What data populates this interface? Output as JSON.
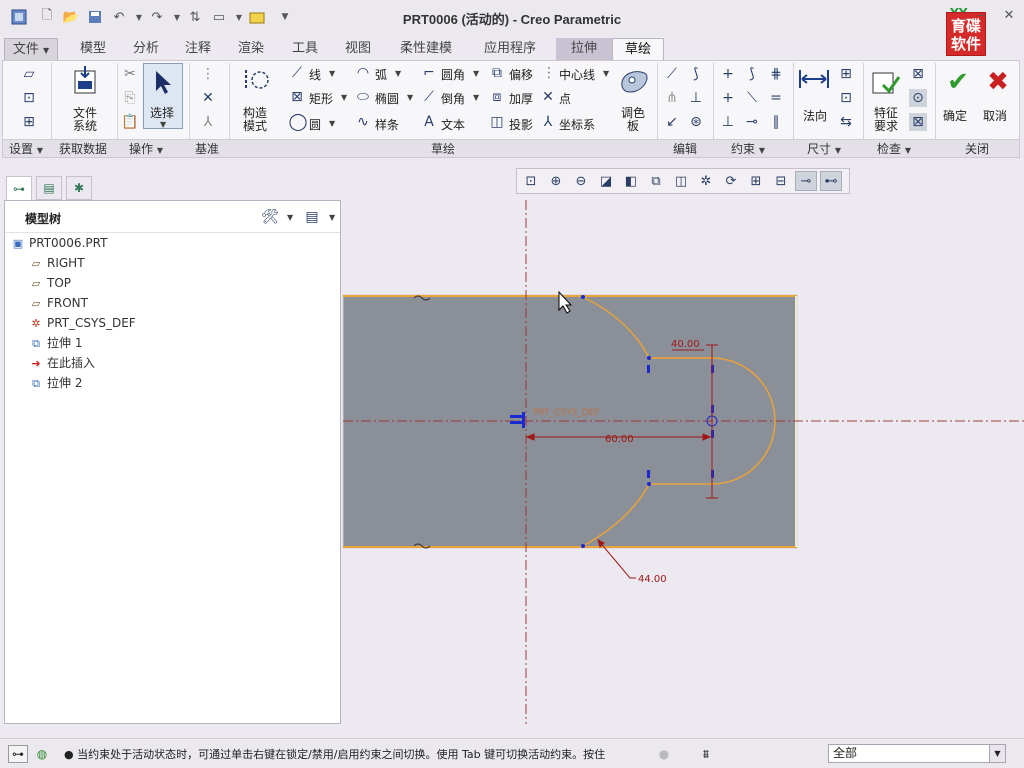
{
  "window": {
    "title": "PRT0006 (活动的) - Creo Parametric",
    "brand_top": "YY",
    "brand": "育碟软件"
  },
  "quick_access": [
    "new-icon",
    "open-icon",
    "save-icon",
    "undo-icon",
    "redo-icon",
    "regenerate-icon",
    "windows-icon",
    "close-window-icon",
    "customize-icon"
  ],
  "ribbon": {
    "tabs": [
      "文件",
      "模型",
      "分析",
      "注释",
      "渲染",
      "工具",
      "视图",
      "柔性建模",
      "应用程序",
      "拉伸",
      "草绘"
    ],
    "active_tab": "草绘",
    "groups": [
      "设置",
      "获取数据",
      "操作",
      "基准",
      "草绘",
      "编辑",
      "约束",
      "尺寸",
      "检查",
      "关闭"
    ],
    "buttons": {
      "file_system": "文件\n系统",
      "select": "选择",
      "construction_mode": "构造\n模式",
      "line": "线",
      "arc": "弧",
      "fillet": "圆角",
      "offset": "偏移",
      "centerline": "中心线",
      "rectangle": "矩形",
      "ellipse": "椭圆",
      "chamfer": "倒角",
      "thicken": "加厚",
      "point": "点",
      "circle": "圆",
      "spline": "样条",
      "text": "文本",
      "project": "投影",
      "coordinate_system": "坐标系",
      "palette": "调色\n板",
      "normal_dim": "法向",
      "feature_req": "特征\n要求",
      "ok": "确定",
      "cancel": "取消"
    }
  },
  "navigator": {
    "title": "模型树",
    "items": [
      {
        "label": "PRT0006.PRT",
        "icon": "part-icon"
      },
      {
        "label": "RIGHT",
        "icon": "datum-plane-icon"
      },
      {
        "label": "TOP",
        "icon": "datum-plane-icon"
      },
      {
        "label": "FRONT",
        "icon": "datum-plane-icon"
      },
      {
        "label": "PRT_CSYS_DEF",
        "icon": "csys-icon"
      },
      {
        "label": "拉伸 1",
        "icon": "extrude-icon"
      },
      {
        "label": "在此插入",
        "icon": "insert-arrow-icon"
      },
      {
        "label": "拉伸 2",
        "icon": "extrude-new-icon"
      }
    ]
  },
  "sketch": {
    "csys_label": "PRT_CSYS_DEF",
    "dimensions": {
      "d1": "40.00",
      "d2": "60.00",
      "d3": "44.00"
    }
  },
  "status": {
    "message": "● 当约束处于活动状态时，可通过单击右键在锁定/禁用/启用约束之间切换。使用 Tab 键可切换活动约束。按住",
    "filter_value": "全部"
  },
  "colors": {
    "model_face": "#8a8f98",
    "sketch_line": "#e8a33a",
    "dimension": "#a01818",
    "constraint": "#1a2ad0",
    "ok_green": "#2f9a2f",
    "cancel_red": "#c82020"
  }
}
